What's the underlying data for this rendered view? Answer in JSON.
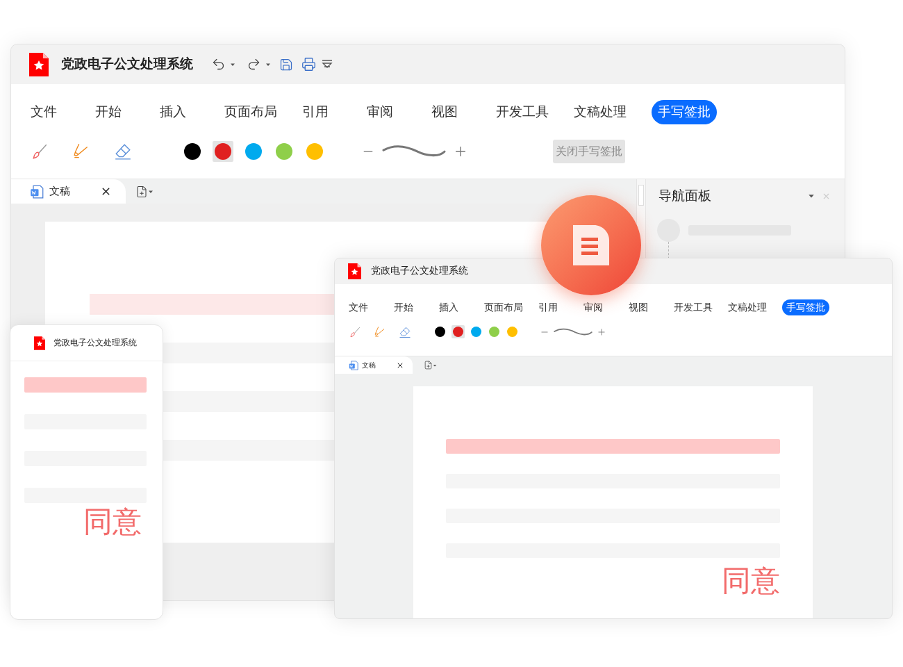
{
  "main_window": {
    "title": "党政电子公文处理系统",
    "menu": [
      {
        "label": "文件",
        "selected": false
      },
      {
        "label": "开始",
        "selected": false
      },
      {
        "label": "插入",
        "selected": false
      },
      {
        "label": "页面布局",
        "selected": false
      },
      {
        "label": "引用",
        "selected": false
      },
      {
        "label": "审阅",
        "selected": false
      },
      {
        "label": "视图",
        "selected": false
      },
      {
        "label": "开发工具",
        "selected": false
      },
      {
        "label": "文稿处理",
        "selected": false
      },
      {
        "label": "手写签批",
        "selected": true
      }
    ],
    "pen_colors": [
      {
        "color": "#000000",
        "selected": false
      },
      {
        "color": "#e02020",
        "selected": true
      },
      {
        "color": "#00aaee",
        "selected": false
      },
      {
        "color": "#8fcf4a",
        "selected": false
      },
      {
        "color": "#ffbf00",
        "selected": false
      }
    ],
    "close_button": "关闭手写签批",
    "doc_tab": "文稿",
    "nav_panel": {
      "title": "导航面板"
    }
  },
  "second_window": {
    "title": "党政电子公文处理系统",
    "menu": [
      {
        "label": "文件",
        "selected": false
      },
      {
        "label": "开始",
        "selected": false
      },
      {
        "label": "插入",
        "selected": false
      },
      {
        "label": "页面布局",
        "selected": false
      },
      {
        "label": "引用",
        "selected": false
      },
      {
        "label": "审阅",
        "selected": false
      },
      {
        "label": "视图",
        "selected": false
      },
      {
        "label": "开发工具",
        "selected": false
      },
      {
        "label": "文稿处理",
        "selected": false
      },
      {
        "label": "手写签批",
        "selected": true
      }
    ],
    "pen_colors": [
      {
        "color": "#000000",
        "selected": false
      },
      {
        "color": "#e02020",
        "selected": true
      },
      {
        "color": "#00aaee",
        "selected": false
      },
      {
        "color": "#8fcf4a",
        "selected": false
      },
      {
        "color": "#ffbf00",
        "selected": false
      }
    ],
    "doc_tab": "文稿",
    "signature": "同意"
  },
  "phone": {
    "title": "党政电子公文处理系统",
    "signature": "同意"
  }
}
